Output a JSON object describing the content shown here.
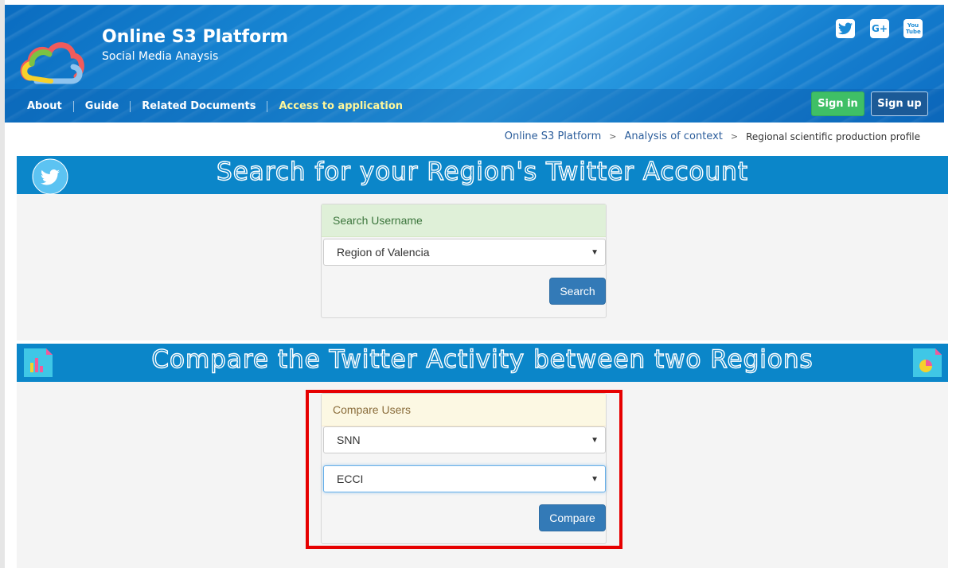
{
  "header": {
    "title": "Online S3 Platform",
    "subtitle": "Social Media Anaysis",
    "social": [
      "twitter-icon",
      "google-plus-icon",
      "youtube-icon"
    ],
    "google_plus_label": "G+",
    "youtube_label": "You Tube",
    "nav": [
      {
        "label": "About"
      },
      {
        "label": "Guide"
      },
      {
        "label": "Related Documents"
      },
      {
        "label": "Access to application",
        "active": true
      }
    ],
    "signin_label": "Sign in",
    "signup_label": "Sign up"
  },
  "breadcrumb": {
    "items": [
      "Online S3 Platform",
      "Analysis of context"
    ],
    "separator": ">",
    "current": "Regional scientific production profile"
  },
  "search_section": {
    "banner_title": "Search for your Region's Twitter Account",
    "panel_title": "Search Username",
    "select_value": "Region of Valencia",
    "button_label": "Search"
  },
  "compare_section": {
    "banner_title": "Compare the Twitter Activity between two Regions",
    "panel_title": "Compare Users",
    "select1_value": "SNN",
    "select2_value": "ECCI",
    "button_label": "Compare"
  },
  "colors": {
    "banner": "#0b86c9",
    "primary": "#337ab7",
    "signin": "#3fbf66",
    "highlight": "#e60000"
  }
}
